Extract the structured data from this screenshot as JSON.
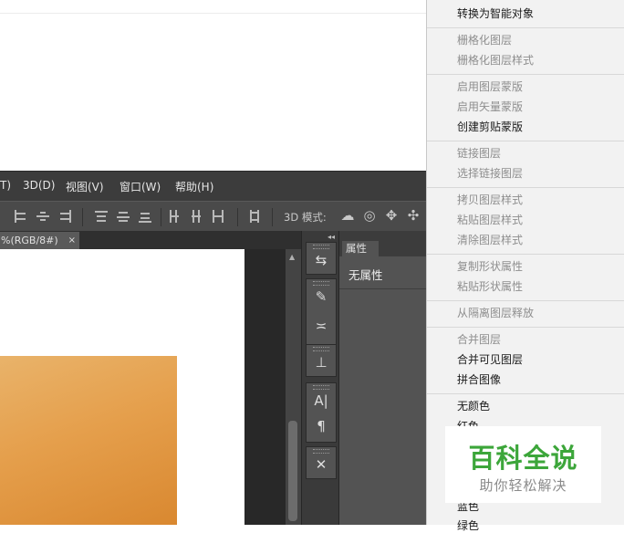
{
  "menubar": {
    "items": [
      "T)",
      "3D(D)",
      "视图(V)",
      "窗口(W)",
      "帮助(H)"
    ]
  },
  "options_bar": {
    "mode_label": "3D 模式:"
  },
  "document_tab": {
    "title": "%(RGB/8#)",
    "close": "×"
  },
  "properties_panel": {
    "tab_label": "属性",
    "empty_text": "无属性"
  },
  "context_menu": {
    "items": [
      {
        "label": "转换为智能对象",
        "enabled": true
      },
      {
        "label": "栅格化图层",
        "enabled": false
      },
      {
        "label": "栅格化图层样式",
        "enabled": false
      },
      {
        "label": "启用图层蒙版",
        "enabled": false
      },
      {
        "label": "启用矢量蒙版",
        "enabled": false
      },
      {
        "label": "创建剪贴蒙版",
        "enabled": true
      },
      {
        "label": "链接图层",
        "enabled": false
      },
      {
        "label": "选择链接图层",
        "enabled": false
      },
      {
        "label": "拷贝图层样式",
        "enabled": false
      },
      {
        "label": "粘贴图层样式",
        "enabled": false
      },
      {
        "label": "清除图层样式",
        "enabled": false
      },
      {
        "label": "复制形状属性",
        "enabled": false
      },
      {
        "label": "粘贴形状属性",
        "enabled": false
      },
      {
        "label": "从隔离图层释放",
        "enabled": false
      },
      {
        "label": "合并图层",
        "enabled": false
      },
      {
        "label": "合并可见图层",
        "enabled": true
      },
      {
        "label": "拼合图像",
        "enabled": true
      },
      {
        "label": "无颜色",
        "enabled": true
      },
      {
        "label": "红色",
        "enabled": true
      },
      {
        "label": "蓝色",
        "enabled": true
      },
      {
        "label": "绿色",
        "enabled": true
      }
    ]
  },
  "watermark": {
    "title": "百科全说",
    "subtitle": "助你轻松解决"
  }
}
